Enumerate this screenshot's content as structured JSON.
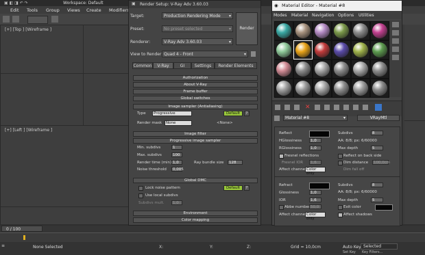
{
  "max": {
    "window_title": "Workspace: Default",
    "menu": [
      "Edit",
      "Tools",
      "Group",
      "Views",
      "Create",
      "Modifiers"
    ],
    "viewport_top_label": "[+] [Top ] [Wireframe ]",
    "viewport_left_label": "[+] [Left ] [Wireframe ]",
    "timeline_counter": "0 / 100",
    "status_text": "None Selected",
    "grid_text": "Grid = 10,0cm",
    "autokey_label": "Auto Key",
    "autokey_value": "Selected",
    "setkey_label": "Set Key",
    "keyfilters_label": "Key Filters...",
    "coord_x": "X:",
    "coord_y": "Y:",
    "coord_z": "Z:",
    "zoom_label": "Zoom:"
  },
  "render_setup": {
    "title": "Render Setup: V-Ray Adv 3.60.03",
    "target_label": "Target:",
    "target_value": "Production Rendering Mode",
    "preset_label": "Preset:",
    "preset_value": "No preset selected",
    "renderer_label": "Renderer:",
    "renderer_value": "V-Ray Adv 3.60.03",
    "render_button": "Render",
    "view_label": "View to Render:",
    "view_value": "Quad 4 - Front",
    "tabs": [
      "Common",
      "V-Ray",
      "GI",
      "Settings",
      "Render Elements"
    ],
    "rollouts": {
      "authorization": "Authorization",
      "about": "About V-Ray",
      "frame_buffer": "Frame buffer",
      "global_switches": "Global switches",
      "image_sampler": "Image sampler (Antialiasing)",
      "image_filter": "Image filter",
      "progressive": "Progressive image sampler",
      "global_dmc": "Global DMC",
      "environment": "Environment",
      "color_mapping": "Color mapping"
    },
    "sampler": {
      "type_label": "Type",
      "type_value": "Progressive",
      "default_button": "Default",
      "help": "?",
      "render_mask_label": "Render mask",
      "render_mask_value": "None",
      "none_label": "<None>"
    },
    "progressive": {
      "min_label": "Min. subdivs",
      "min_value": "1",
      "max_label": "Max. subdivs",
      "max_value": "100",
      "time_label": "Render time (min)",
      "time_value": "1,0",
      "bundle_label": "Ray bundle size",
      "bundle_value": "128",
      "noise_label": "Noise threshold",
      "noise_value": "0,005"
    },
    "dmc": {
      "lock_label": "Lock noise pattern",
      "default_button": "Default",
      "local_label": "Use local subdivs",
      "subdiv_mult_label": "Subdivs mult.",
      "subdiv_mult_value": "1,0"
    }
  },
  "material_editor": {
    "title": "Material Editor - Material #8",
    "menu": [
      "Modes",
      "Material",
      "Navigation",
      "Options",
      "Utilities"
    ],
    "material_name": "Material #8",
    "material_type": "VRayMtl",
    "reflect": {
      "reflect_label": "Reflect",
      "subdivs_label": "Subdivs",
      "subdivs_value": "8",
      "hgloss_label": "HGlossiness",
      "hgloss_value": "1,0",
      "aa_label": "AA: 8/8; px: 6/60000",
      "rgloss_label": "RGlossiness",
      "rgloss_value": "1,0",
      "max_depth_label": "Max depth",
      "max_depth_value": "5",
      "fresnel_label": "Fresnel reflections",
      "back_label": "Reflect on back side",
      "fresnel_ior_label": "Fresnel IOR",
      "fresnel_ior_value": "1,6",
      "dim_label": "Dim distance",
      "dim_value": "100,0cm",
      "exit_label": "Exit color",
      "dim_falloff_label": "Dim fall off",
      "affect_label": "Affect channels",
      "affect_value": "Color only"
    },
    "refract": {
      "refract_label": "Refract",
      "subdivs_label": "Subdivs",
      "subdivs_value": "8",
      "aa_label": "AA: 8/8; px: 6/60000",
      "gloss_label": "Glossiness",
      "gloss_value": "1,0",
      "ior_label": "IOR",
      "ior_value": "1,6",
      "max_depth_label": "Max depth",
      "max_depth_value": "5",
      "abbe_label": "Abbe number",
      "abbe_value": "50,0",
      "exit_label": "Exit color",
      "affect_label": "Affect channels",
      "affect_value": "Color only",
      "shadows_label": "Affect shadows"
    },
    "sphere_colors": [
      "#3aa9a4",
      "#a8937f",
      "#b48bc4",
      "#7c9a4a",
      "#8d8d8d",
      "#c2408f",
      "#8fc99a",
      "#e8a318",
      "#c23b3b",
      "#5a4ba8",
      "#9fb24a",
      "#5c9a4e",
      "#d08a94",
      "#8d8d8d",
      "#a8a8a8",
      "#8d8d8d",
      "#aaaaaa",
      "#8d8d8d",
      "#a0a0a0",
      "#9a9a9a",
      "#a8a8a8",
      "#8e8e8e",
      "#9d9d9d",
      "#8a8a8a"
    ]
  }
}
